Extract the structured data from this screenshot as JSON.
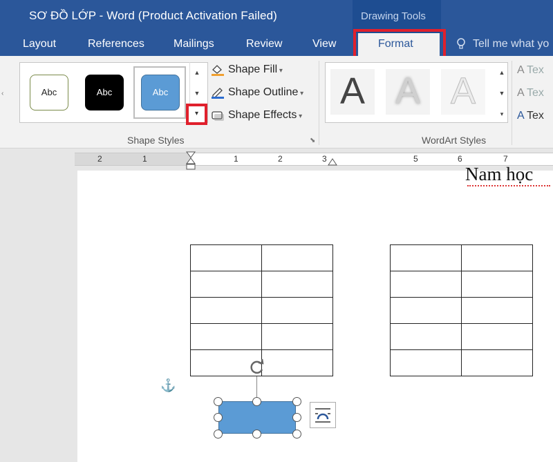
{
  "window": {
    "title": "SƠ ĐỒ LỚP - Word (Product Activation Failed)"
  },
  "context_tab_group": "Drawing Tools",
  "tabs": [
    {
      "label": "Layout"
    },
    {
      "label": "References"
    },
    {
      "label": "Mailings"
    },
    {
      "label": "Review"
    },
    {
      "label": "View"
    },
    {
      "label": "Format"
    }
  ],
  "tell_me": "Tell me what yo",
  "shape_styles": {
    "presets": [
      "Abc",
      "Abc",
      "Abc"
    ],
    "commands": {
      "fill": "Shape Fill",
      "outline": "Shape Outline",
      "effects": "Shape Effects"
    },
    "group_label": "Shape Styles"
  },
  "wordart": {
    "presets": [
      "A",
      "A",
      "A"
    ],
    "text_commands": [
      "Tex",
      "Tex",
      "Tex"
    ],
    "group_label": "WordArt Styles"
  },
  "ruler": {
    "numbers": [
      "2",
      "1",
      "1",
      "2",
      "3",
      "5",
      "6",
      "7"
    ]
  },
  "document": {
    "heading_fragment": "Nam học"
  },
  "colors": {
    "accent": "#2b579a",
    "highlight": "#e0202c",
    "shape_fill": "#5b9bd5"
  }
}
